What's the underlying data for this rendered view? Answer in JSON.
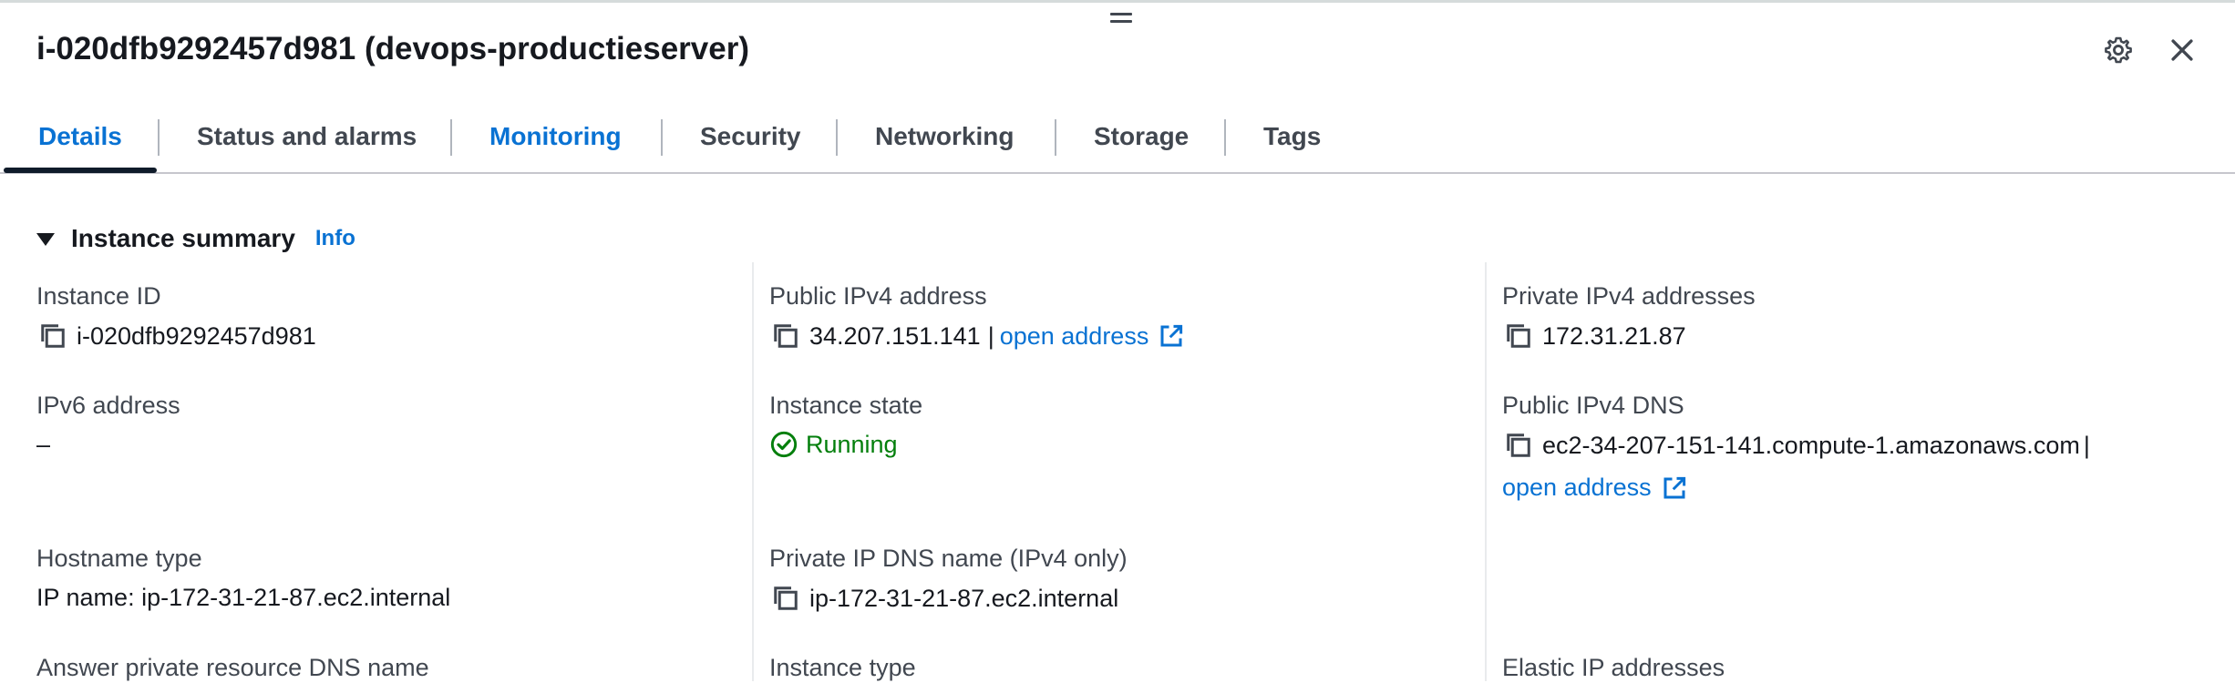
{
  "panel": {
    "title": "i-020dfb9292457d981 (devops-productieserver)"
  },
  "tabs": [
    {
      "label": "Details",
      "state": "active"
    },
    {
      "label": "Status and alarms",
      "state": "normal"
    },
    {
      "label": "Monitoring",
      "state": "link"
    },
    {
      "label": "Security",
      "state": "normal"
    },
    {
      "label": "Networking",
      "state": "normal"
    },
    {
      "label": "Storage",
      "state": "normal"
    },
    {
      "label": "Tags",
      "state": "normal"
    }
  ],
  "summary": {
    "title": "Instance summary",
    "info_label": "Info"
  },
  "fields": {
    "instance_id": {
      "label": "Instance ID",
      "value": "i-020dfb9292457d981"
    },
    "public_ipv4": {
      "label": "Public IPv4 address",
      "value": "34.207.151.141",
      "separator": "|",
      "link": "open address"
    },
    "private_ipv4": {
      "label": "Private IPv4 addresses",
      "value": "172.31.21.87"
    },
    "ipv6": {
      "label": "IPv6 address",
      "value": "–"
    },
    "instance_state": {
      "label": "Instance state",
      "value": "Running"
    },
    "public_dns": {
      "label": "Public IPv4 DNS",
      "value": "ec2-34-207-151-141.compute-1.amazonaws.com",
      "separator": "|",
      "link": "open address"
    },
    "hostname_type": {
      "label": "Hostname type",
      "value": "IP name: ip-172-31-21-87.ec2.internal"
    },
    "private_dns": {
      "label": "Private IP DNS name (IPv4 only)",
      "value": "ip-172-31-21-87.ec2.internal"
    },
    "answer_dns": {
      "label": "Answer private resource DNS name"
    },
    "instance_type": {
      "label": "Instance type"
    },
    "elastic_ip": {
      "label": "Elastic IP addresses"
    }
  },
  "colors": {
    "link": "#0972d3",
    "running": "#037f0c",
    "text": "#16191f",
    "label": "#414750"
  }
}
